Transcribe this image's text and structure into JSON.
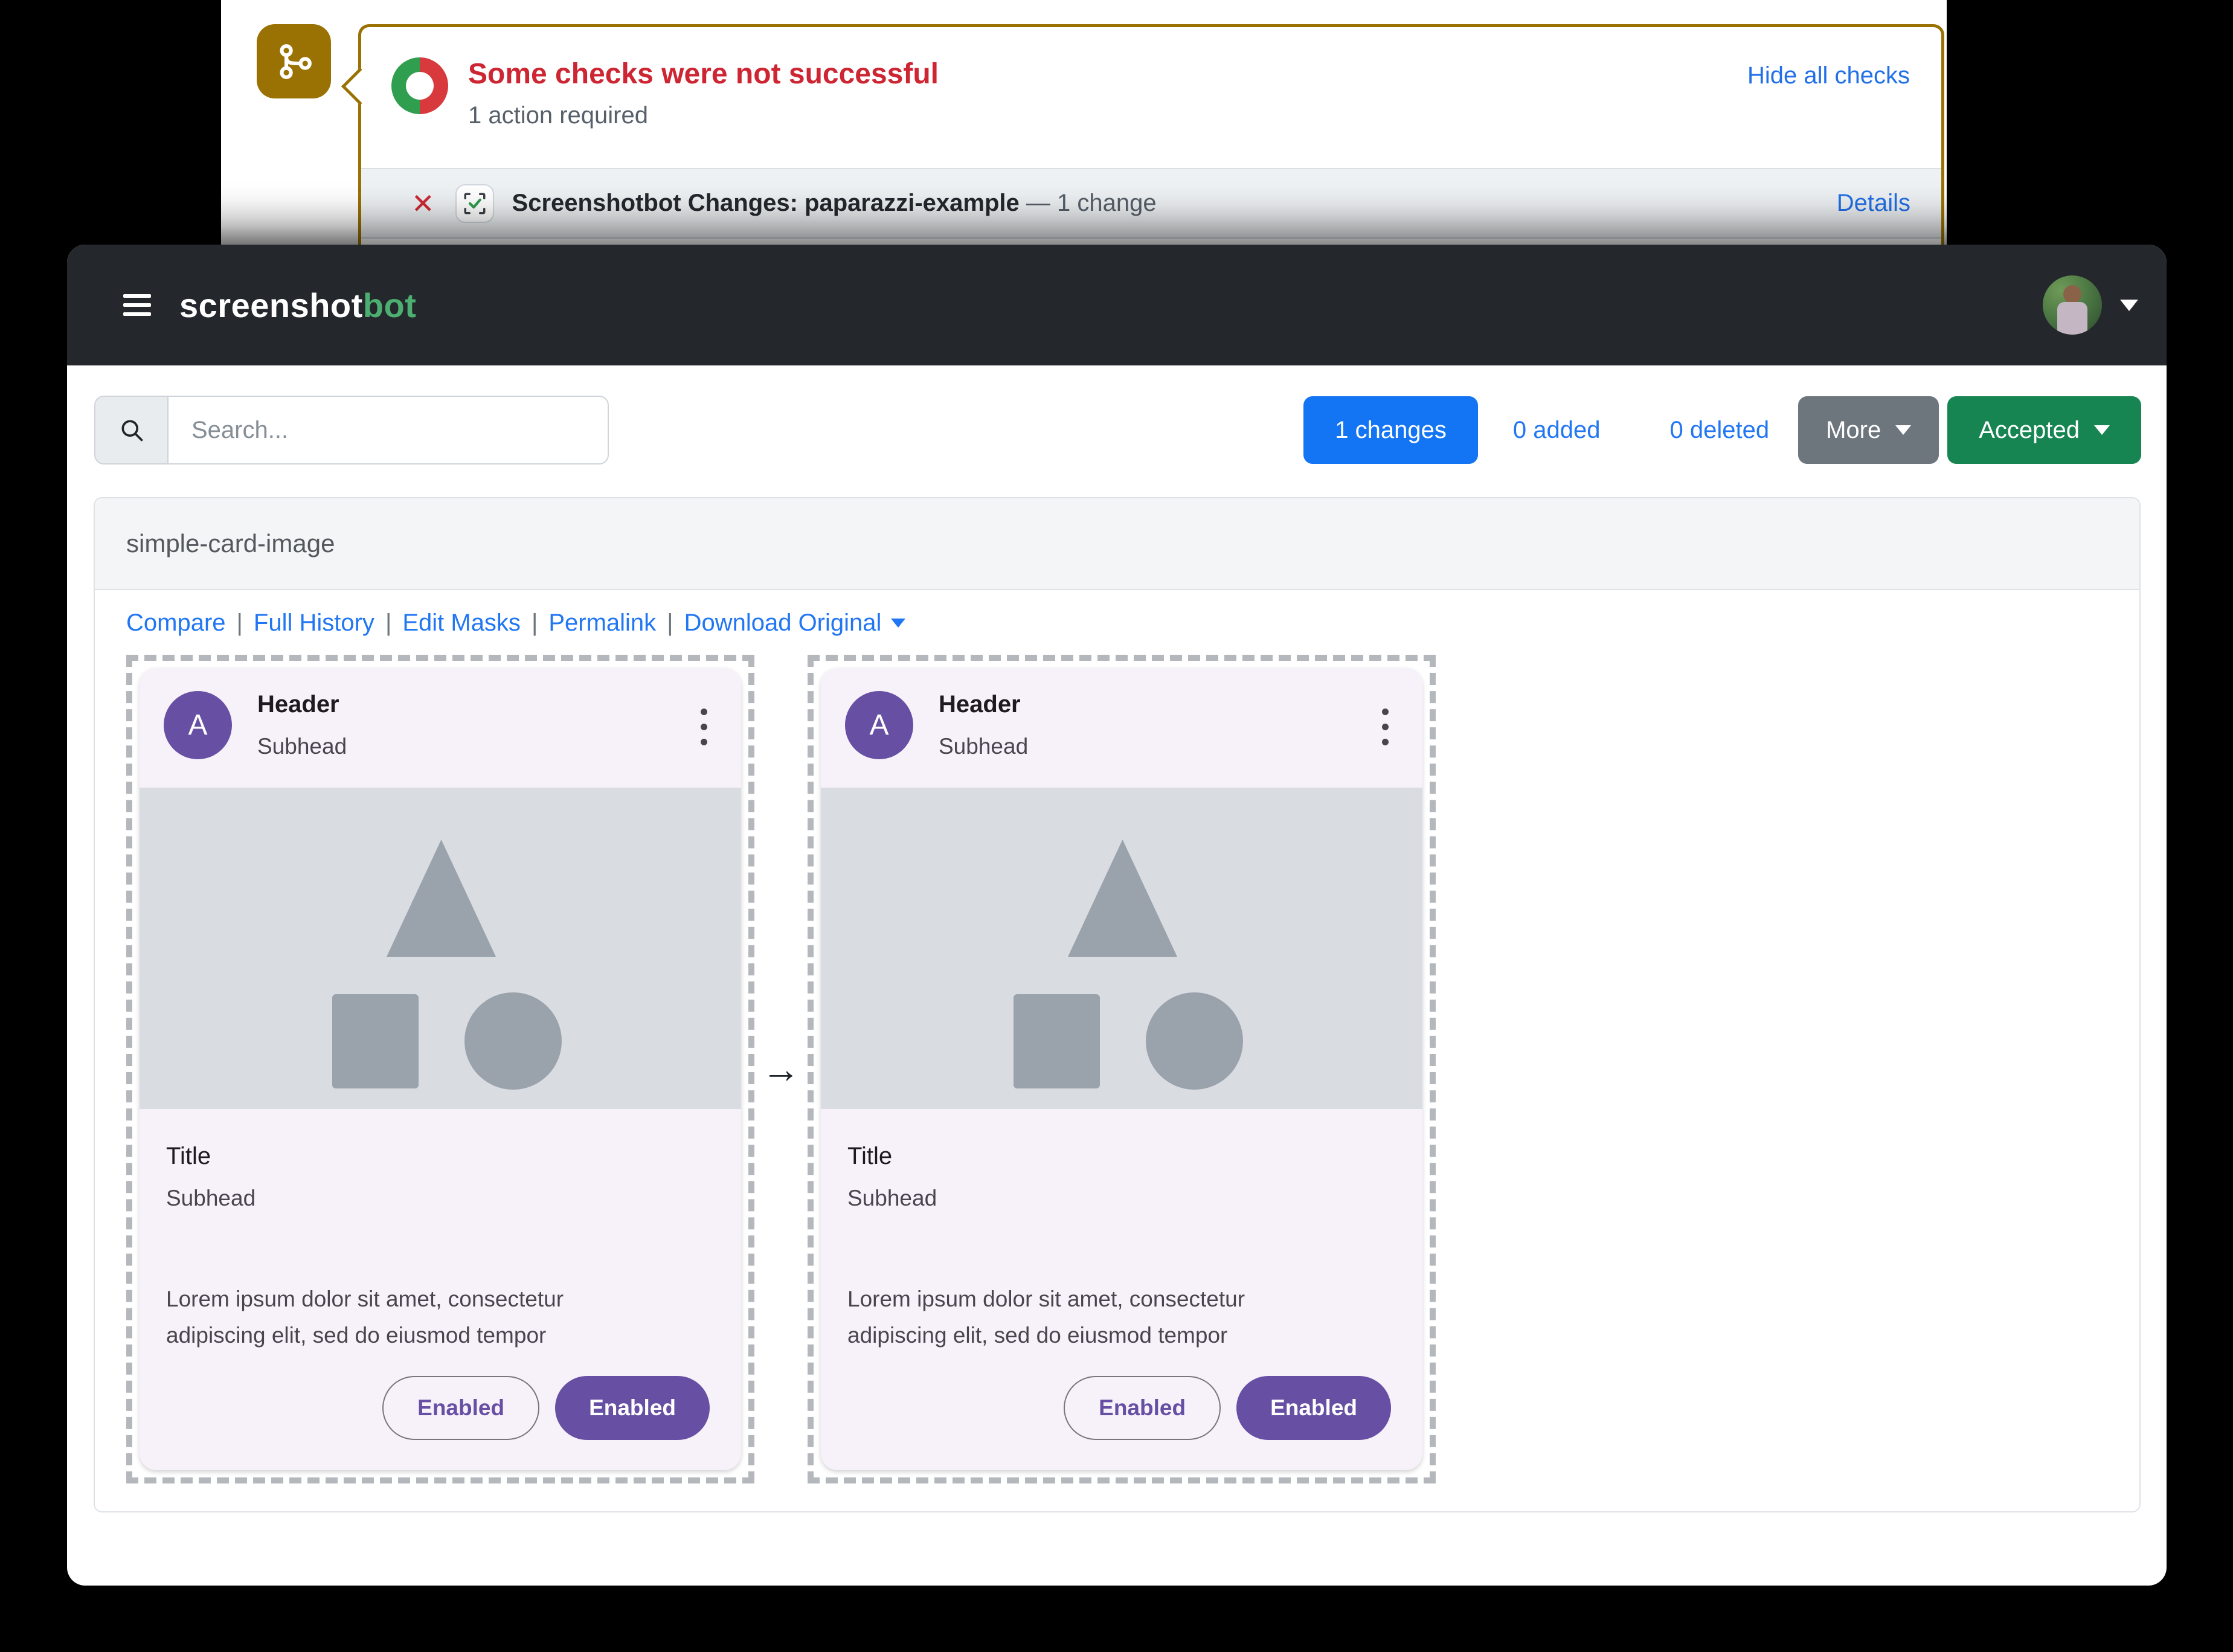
{
  "checks": {
    "title": "Some checks were not successful",
    "subtitle": "1 action required",
    "hide_link": "Hide all checks",
    "row": {
      "name": "Screenshotbot Changes: paparazzi-example",
      "dash": " — ",
      "count": "1 change",
      "details": "Details"
    },
    "colors": {
      "border_gold": "#9a7103",
      "title_red": "#ce2532",
      "fail_red": "#d8393d",
      "pass_green": "#2f9e4f",
      "link_blue": "#2270e8"
    }
  },
  "nav": {
    "logo_primary": "screenshot",
    "logo_accent": "bot",
    "accent_color": "#4cae70"
  },
  "toolbar": {
    "search_placeholder": "Search...",
    "changes_button": "1 changes",
    "added_link": "0 added",
    "deleted_link": "0 deleted",
    "more_button": "More",
    "accepted_button": "Accepted",
    "colors": {
      "primary_blue": "#1375f3",
      "secondary_gray": "#6d757d",
      "success_green": "#178552"
    }
  },
  "report": {
    "title": "simple-card-image",
    "sep": "|",
    "links": [
      "Compare",
      "Full History",
      "Edit Masks",
      "Permalink",
      "Download Original"
    ]
  },
  "shot": {
    "avatar_letter": "A",
    "header": "Header",
    "subhead": "Subhead",
    "title": "Title",
    "title_subhead": "Subhead",
    "body_line1": "Lorem ipsum dolor sit amet, consectetur",
    "body_line2": "adipiscing elit, sed do eiusmod tempor",
    "button_outlined": "Enabled",
    "button_filled": "Enabled",
    "accent_purple": "#6750a4"
  },
  "icons": {
    "fail_x": "✕",
    "arrow_right": "→"
  }
}
